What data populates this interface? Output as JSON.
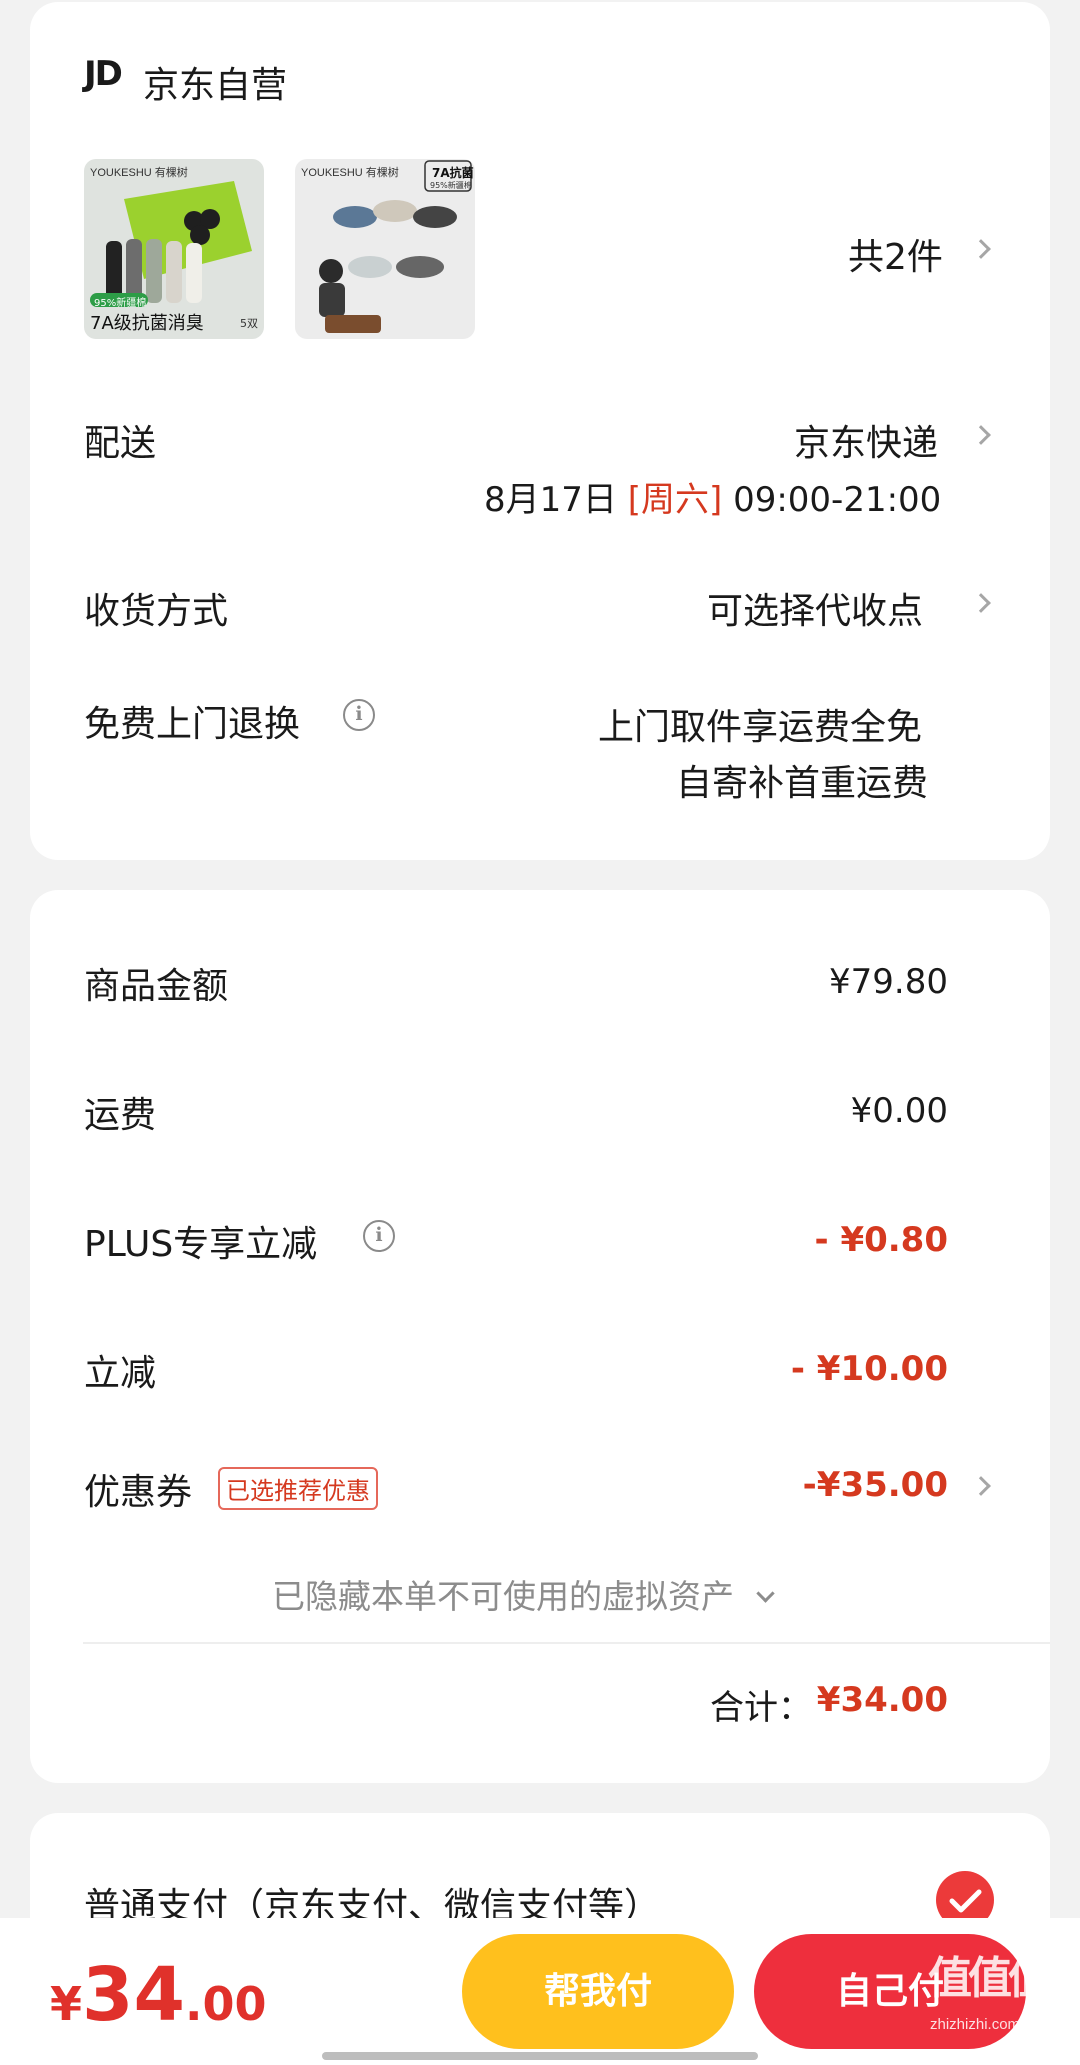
{
  "shop": {
    "logo": "JD",
    "name": "京东自营"
  },
  "products": {
    "count_label": "共2件",
    "items": [
      {
        "brand": "YOUKESHU 有棵树",
        "badge": "95%新疆棉",
        "caption": "7A级抗菌消臭",
        "pairs": "5双"
      },
      {
        "brand": "YOUKESHU 有棵树",
        "badge_line1": "7A抗菌",
        "badge_line2": "95%新疆棉"
      }
    ]
  },
  "delivery": {
    "label": "配送",
    "carrier": "京东快递",
    "date": "8月17日",
    "weekday": "[周六]",
    "time": "09:00-21:00"
  },
  "receive": {
    "label": "收货方式",
    "value": "可选择代收点"
  },
  "return": {
    "label": "免费上门退换",
    "info_icon": "i",
    "line1": "上门取件享运费全免",
    "line2": "自寄补首重运费"
  },
  "price": {
    "goods": {
      "label": "商品金额",
      "value": "¥79.80"
    },
    "shipping": {
      "label": "运费",
      "value": "¥0.00"
    },
    "plus": {
      "label": "PLUS专享立减",
      "value": "- ¥0.80"
    },
    "instant": {
      "label": "立减",
      "value": "- ¥10.00"
    },
    "coupon": {
      "label": "优惠券",
      "tag": "已选推荐优惠",
      "value": "-¥35.00"
    },
    "hidden_assets": "已隐藏本单不可使用的虚拟资产",
    "total_label": "合计：",
    "total_value": "¥34.00"
  },
  "payment": {
    "label": "普通支付（京东支付、微信支付等）"
  },
  "bottom": {
    "currency": "¥",
    "amount_int": "34",
    "amount_dec": ".00",
    "help_pay": "帮我付",
    "self_pay": "自己付"
  },
  "watermark": {
    "mark": "值值值",
    "site": "zhizhizhi.com"
  },
  "colors": {
    "accent_red": "#d5391f",
    "button_yellow": "#ffc01d",
    "button_red": "#ee2f3d"
  },
  "icons": [
    "chevron-right-icon",
    "info-icon",
    "chevron-down-icon",
    "check-circle-icon"
  ]
}
